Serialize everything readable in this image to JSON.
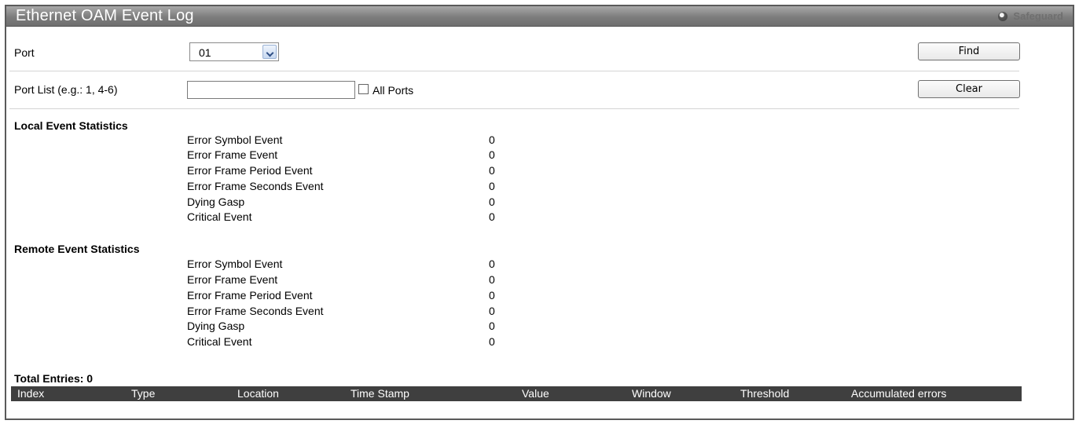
{
  "header": {
    "title": "Ethernet OAM Event Log",
    "safeguard": "Safeguard"
  },
  "form": {
    "port_label": "Port",
    "port_value": "01",
    "find_label": "Find",
    "portlist_label": "Port List (e.g.: 1, 4-6)",
    "portlist_value": "",
    "allports_label": "All Ports",
    "allports_checked": false,
    "clear_label": "Clear"
  },
  "local": {
    "title": "Local Event Statistics",
    "items": [
      {
        "name": "Error Symbol Event",
        "value": "0"
      },
      {
        "name": "Error Frame Event",
        "value": "0"
      },
      {
        "name": "Error Frame Period Event",
        "value": "0"
      },
      {
        "name": "Error Frame Seconds Event",
        "value": "0"
      },
      {
        "name": "Dying Gasp",
        "value": "0"
      },
      {
        "name": "Critical Event",
        "value": "0"
      }
    ]
  },
  "remote": {
    "title": "Remote Event Statistics",
    "items": [
      {
        "name": "Error Symbol Event",
        "value": "0"
      },
      {
        "name": "Error Frame Event",
        "value": "0"
      },
      {
        "name": "Error Frame Period Event",
        "value": "0"
      },
      {
        "name": "Error Frame Seconds Event",
        "value": "0"
      },
      {
        "name": "Dying Gasp",
        "value": "0"
      },
      {
        "name": "Critical Event",
        "value": "0"
      }
    ]
  },
  "table": {
    "total_entries": "Total Entries: 0",
    "columns": [
      "Index",
      "Type",
      "Location",
      "Time Stamp",
      "Value",
      "Window",
      "Threshold",
      "Accumulated errors"
    ]
  }
}
